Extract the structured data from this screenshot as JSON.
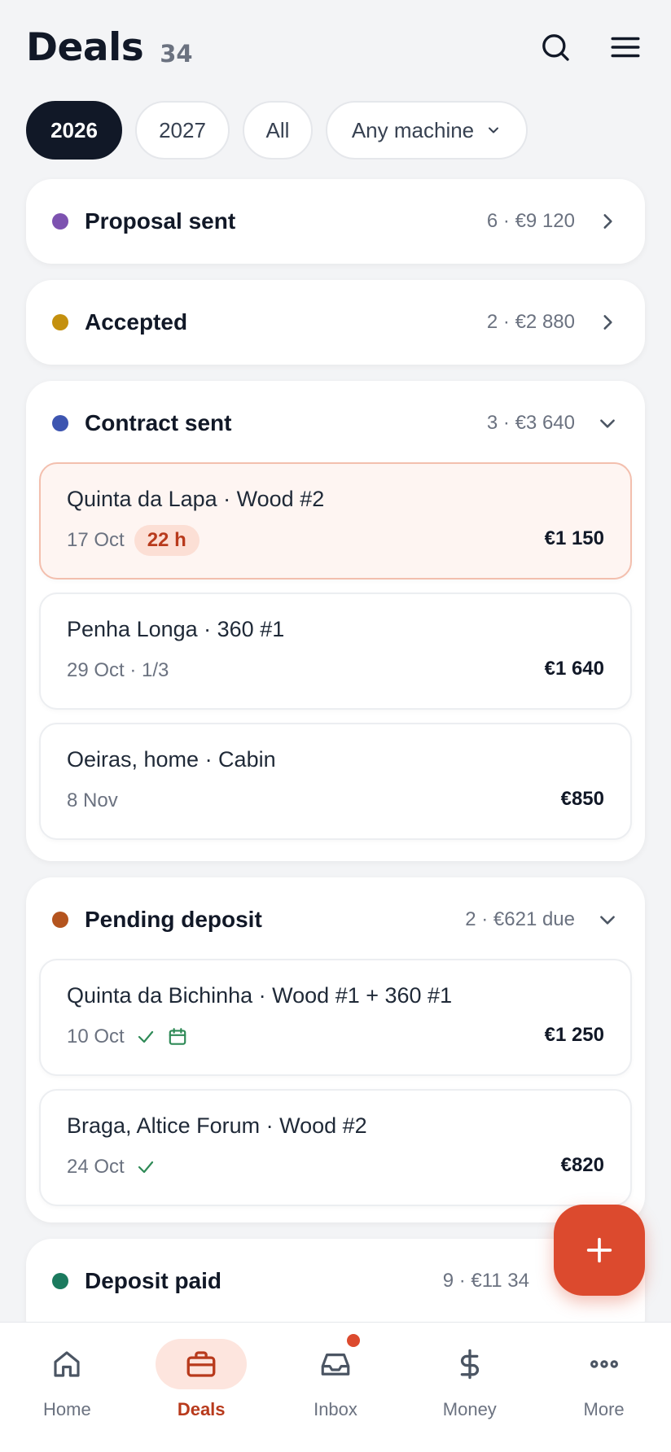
{
  "header": {
    "title": "Deals",
    "count": "34"
  },
  "filters": {
    "chips": [
      "2026",
      "2027",
      "All"
    ],
    "active": "2026",
    "machine": "Any machine"
  },
  "stages": [
    {
      "name": "Proposal sent",
      "meta": "6 · €9 120",
      "color": "#7d52b0",
      "expanded": false
    },
    {
      "name": "Accepted",
      "meta": "2 · €2 880",
      "color": "#c4900e",
      "expanded": false
    },
    {
      "name": "Contract sent",
      "meta": "3 · €3 640",
      "color": "#3d55b0",
      "expanded": true,
      "deals": [
        {
          "title": "Quinta da Lapa · Wood #2",
          "date": "17 Oct",
          "urgent": "22 h",
          "amount": "€1 150"
        },
        {
          "title": "Penha Longa · 360 #1",
          "date": "29 Oct · 1/3",
          "amount": "€1 640"
        },
        {
          "title": "Oeiras, home · Cabin",
          "date": "8 Nov",
          "amount": "€850"
        }
      ]
    },
    {
      "name": "Pending deposit",
      "meta": "2 · €621 due",
      "color": "#b4541e",
      "expanded": true,
      "deals": [
        {
          "title": "Quinta da Bichinha · Wood #1 + 360 #1",
          "date": "10 Oct",
          "icons": [
            "check-icon",
            "calendar-icon"
          ],
          "amount": "€1 250"
        },
        {
          "title": "Braga, Altice Forum · Wood #2",
          "date": "24 Oct",
          "icons": [
            "check-icon"
          ],
          "amount": "€820"
        }
      ]
    },
    {
      "name": "Deposit paid",
      "meta": "9 · €11 34",
      "color": "#1b7a5e",
      "expanded": false
    }
  ],
  "nav": {
    "items": [
      {
        "label": "Home",
        "icon": "home-icon"
      },
      {
        "label": "Deals",
        "icon": "briefcase-icon"
      },
      {
        "label": "Inbox",
        "icon": "inbox-icon"
      },
      {
        "label": "Money",
        "icon": "dollar-icon"
      },
      {
        "label": "More",
        "icon": "more-icon"
      }
    ],
    "active": "Deals"
  },
  "colors": {
    "accent": "#dc4a2e",
    "dark": "#111827",
    "success": "#2f8a57"
  }
}
